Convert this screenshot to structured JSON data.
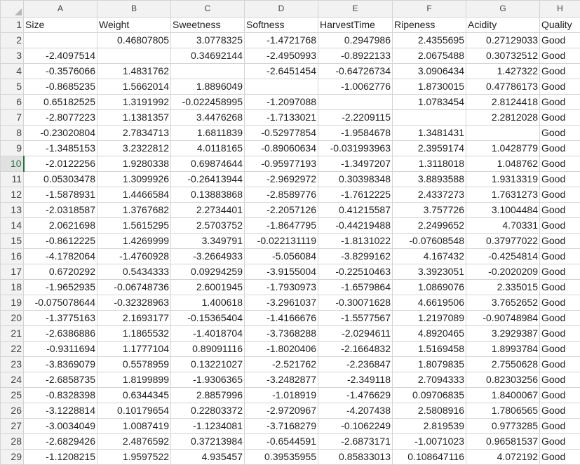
{
  "column_letters": [
    "A",
    "B",
    "C",
    "D",
    "E",
    "F",
    "G",
    "H"
  ],
  "active_row": 10,
  "rows": [
    {
      "n": "1",
      "cells": [
        "Size",
        "Weight",
        "Sweetness",
        "Softness",
        "HarvestTime",
        "Ripeness",
        "Acidity",
        "Quality"
      ]
    },
    {
      "n": "2",
      "cells": [
        "",
        "0.46807805",
        "3.0778325",
        "-1.4721768",
        "0.2947986",
        "2.4355695",
        "0.27129033",
        "Good"
      ]
    },
    {
      "n": "3",
      "cells": [
        "-2.4097514",
        "",
        "0.34692144",
        "-2.4950993",
        "-0.8922133",
        "2.0675488",
        "0.30732512",
        "Good"
      ]
    },
    {
      "n": "4",
      "cells": [
        "-0.3576066",
        "1.4831762",
        "",
        "-2.6451454",
        "-0.64726734",
        "3.0906434",
        "1.427322",
        "Good"
      ]
    },
    {
      "n": "5",
      "cells": [
        "-0.8685235",
        "1.5662014",
        "1.8896049",
        "",
        "-1.0062776",
        "1.8730015",
        "0.47786173",
        "Good"
      ]
    },
    {
      "n": "6",
      "cells": [
        "0.65182525",
        "1.3191992",
        "-0.022458995",
        "-1.2097088",
        "",
        "1.0783454",
        "2.8124418",
        "Good"
      ]
    },
    {
      "n": "7",
      "cells": [
        "-2.8077223",
        "1.1381357",
        "3.4476268",
        "-1.7133021",
        "-2.2209115",
        "",
        "2.2812028",
        "Good"
      ]
    },
    {
      "n": "8",
      "cells": [
        "-0.23020804",
        "2.7834713",
        "1.6811839",
        "-0.52977854",
        "-1.9584678",
        "1.3481431",
        "",
        "Good"
      ]
    },
    {
      "n": "9",
      "cells": [
        "-1.3485153",
        "3.2322812",
        "4.0118165",
        "-0.89060634",
        "-0.031993963",
        "2.3959174",
        "1.0428779",
        "Good"
      ]
    },
    {
      "n": "10",
      "cells": [
        "-2.0122256",
        "1.9280338",
        "0.69874644",
        "-0.95977193",
        "-1.3497207",
        "1.3118018",
        "1.048762",
        "Good"
      ]
    },
    {
      "n": "11",
      "cells": [
        "0.05303478",
        "1.3099926",
        "-0.26413944",
        "-2.9692972",
        "0.30398348",
        "3.8893588",
        "1.9313319",
        "Good"
      ]
    },
    {
      "n": "12",
      "cells": [
        "-1.5878931",
        "1.4466584",
        "0.13883868",
        "-2.8589776",
        "-1.7612225",
        "2.4337273",
        "1.7631273",
        "Good"
      ]
    },
    {
      "n": "13",
      "cells": [
        "-2.0318587",
        "1.3767682",
        "2.2734401",
        "-2.2057126",
        "0.41215587",
        "3.757726",
        "3.1004484",
        "Good"
      ]
    },
    {
      "n": "14",
      "cells": [
        "2.0621698",
        "1.5615295",
        "2.5703752",
        "-1.8647795",
        "-0.44219488",
        "2.2499652",
        "4.70331",
        "Good"
      ]
    },
    {
      "n": "15",
      "cells": [
        "-0.8612225",
        "1.4269999",
        "3.349791",
        "-0.022131119",
        "-1.8131022",
        "-0.07608548",
        "0.37977022",
        "Good"
      ]
    },
    {
      "n": "16",
      "cells": [
        "-4.1782064",
        "-1.4760928",
        "-3.2664933",
        "-5.056084",
        "-3.8299162",
        "4.167432",
        "-0.4254814",
        "Good"
      ]
    },
    {
      "n": "17",
      "cells": [
        "0.6720292",
        "0.5434333",
        "0.09294259",
        "-3.9155004",
        "-0.22510463",
        "3.3923051",
        "-0.2020209",
        "Good"
      ]
    },
    {
      "n": "18",
      "cells": [
        "-1.9652935",
        "-0.06748736",
        "2.6001945",
        "-1.7930973",
        "-1.6579864",
        "1.0869076",
        "2.335015",
        "Good"
      ]
    },
    {
      "n": "19",
      "cells": [
        "-0.075078644",
        "-0.32328963",
        "1.400618",
        "-3.2961037",
        "-0.30071628",
        "4.6619506",
        "3.7652652",
        "Good"
      ]
    },
    {
      "n": "20",
      "cells": [
        "-1.3775163",
        "2.1693177",
        "-0.15365404",
        "-1.4166676",
        "-1.5577567",
        "1.2197089",
        "-0.90748984",
        "Good"
      ]
    },
    {
      "n": "21",
      "cells": [
        "-2.6386886",
        "1.1865532",
        "-1.4018704",
        "-3.7368288",
        "-2.0294611",
        "4.8920465",
        "3.2929387",
        "Good"
      ]
    },
    {
      "n": "22",
      "cells": [
        "-0.9311694",
        "1.1777104",
        "0.89091116",
        "-1.8020406",
        "-2.1664832",
        "1.5169458",
        "1.8993784",
        "Good"
      ]
    },
    {
      "n": "23",
      "cells": [
        "-3.8369079",
        "0.5578959",
        "0.13221027",
        "-2.521762",
        "-2.236847",
        "1.8079835",
        "2.7550628",
        "Good"
      ]
    },
    {
      "n": "24",
      "cells": [
        "-2.6858735",
        "1.8199899",
        "-1.9306365",
        "-3.2482877",
        "-2.349118",
        "2.7094333",
        "0.82303256",
        "Good"
      ]
    },
    {
      "n": "25",
      "cells": [
        "-0.8328398",
        "0.6344345",
        "2.8857996",
        "-1.018919",
        "-1.476629",
        "0.09706835",
        "1.8400067",
        "Good"
      ]
    },
    {
      "n": "26",
      "cells": [
        "-3.1228814",
        "0.10179654",
        "0.22803372",
        "-2.9720967",
        "-4.207438",
        "2.5808916",
        "1.7806565",
        "Good"
      ]
    },
    {
      "n": "27",
      "cells": [
        "-3.0034049",
        "1.0087419",
        "-1.1234081",
        "-3.7168279",
        "-0.1062249",
        "2.819539",
        "0.9773285",
        "Good"
      ]
    },
    {
      "n": "28",
      "cells": [
        "-2.6829426",
        "2.4876592",
        "0.37213984",
        "-0.6544591",
        "-2.6873171",
        "-1.0071023",
        "0.96581537",
        "Good"
      ]
    },
    {
      "n": "29",
      "cells": [
        "-1.1208215",
        "1.9597522",
        "4.935457",
        "0.39535955",
        "0.85833013",
        "0.108647116",
        "4.072192",
        "Good"
      ]
    }
  ]
}
